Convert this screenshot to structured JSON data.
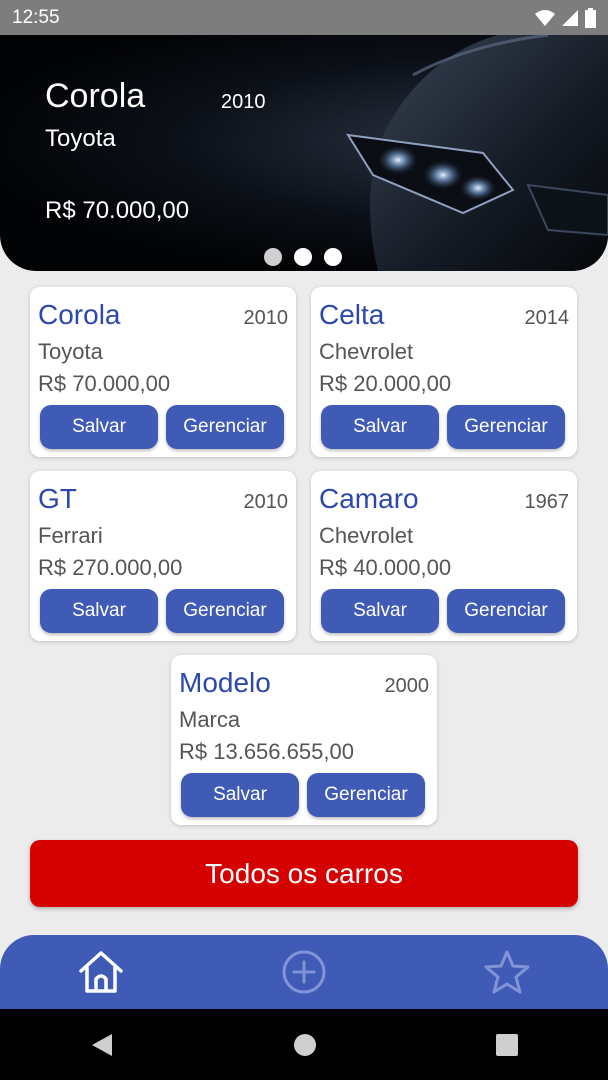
{
  "status_bar": {
    "time": "12:55"
  },
  "banner": {
    "model": "Corola",
    "year": "2010",
    "brand": "Toyota",
    "price": "R$ 70.000,00",
    "dots": 3
  },
  "cars": [
    {
      "model": "Corola",
      "year": "2010",
      "brand": "Toyota",
      "price": "R$ 70.000,00"
    },
    {
      "model": "Celta",
      "year": "2014",
      "brand": "Chevrolet",
      "price": "R$ 20.000,00"
    },
    {
      "model": "GT",
      "year": "2010",
      "brand": "Ferrari",
      "price": "R$ 270.000,00"
    },
    {
      "model": "Camaro",
      "year": "1967",
      "brand": "Chevrolet",
      "price": "R$ 40.000,00"
    },
    {
      "model": "Modelo",
      "year": "2000",
      "brand": "Marca",
      "price": "R$ 13.656.655,00"
    }
  ],
  "labels": {
    "save": "Salvar",
    "manage": "Gerenciar",
    "all_cars": "Todos os carros"
  },
  "bottom_nav": [
    "home-icon",
    "add-circle-icon",
    "star-icon"
  ],
  "colors": {
    "primary": "#3f5bb6",
    "accent_red": "#d50000",
    "title_blue": "#2c48ad"
  }
}
